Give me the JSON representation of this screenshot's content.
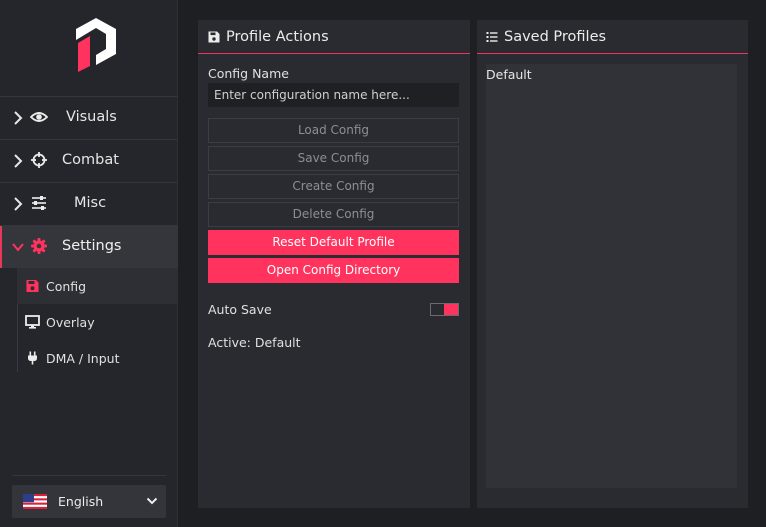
{
  "colors": {
    "accent": "#ff335d",
    "sidebar_bg": "#25262b",
    "panel_bg": "#2a2b30"
  },
  "sidebar": {
    "items": [
      {
        "label": "Visuals",
        "icon": "eye-icon"
      },
      {
        "label": "Combat",
        "icon": "crosshair-icon"
      },
      {
        "label": "Misc",
        "icon": "sliders-icon"
      },
      {
        "label": "Settings",
        "icon": "gear-icon",
        "expanded": true
      }
    ],
    "sub_items": [
      {
        "label": "Config",
        "icon": "floppy-disk-icon",
        "selected": true
      },
      {
        "label": "Overlay",
        "icon": "monitor-icon"
      },
      {
        "label": "DMA / Input",
        "icon": "plug-icon"
      }
    ],
    "language": {
      "label": "English",
      "icon": "us-flag-icon"
    }
  },
  "profile_actions": {
    "title": "Profile Actions",
    "config_name_label": "Config Name",
    "config_name_placeholder": "Enter configuration name here...",
    "config_name_value": "",
    "buttons": {
      "load": "Load Config",
      "save": "Save Config",
      "create": "Create Config",
      "delete": "Delete Config",
      "reset": "Reset Default Profile",
      "open_dir": "Open Config Directory"
    },
    "auto_save_label": "Auto Save",
    "auto_save_on": true,
    "active_label": "Active: Default"
  },
  "saved_profiles": {
    "title": "Saved Profiles",
    "items": [
      "Default"
    ]
  }
}
